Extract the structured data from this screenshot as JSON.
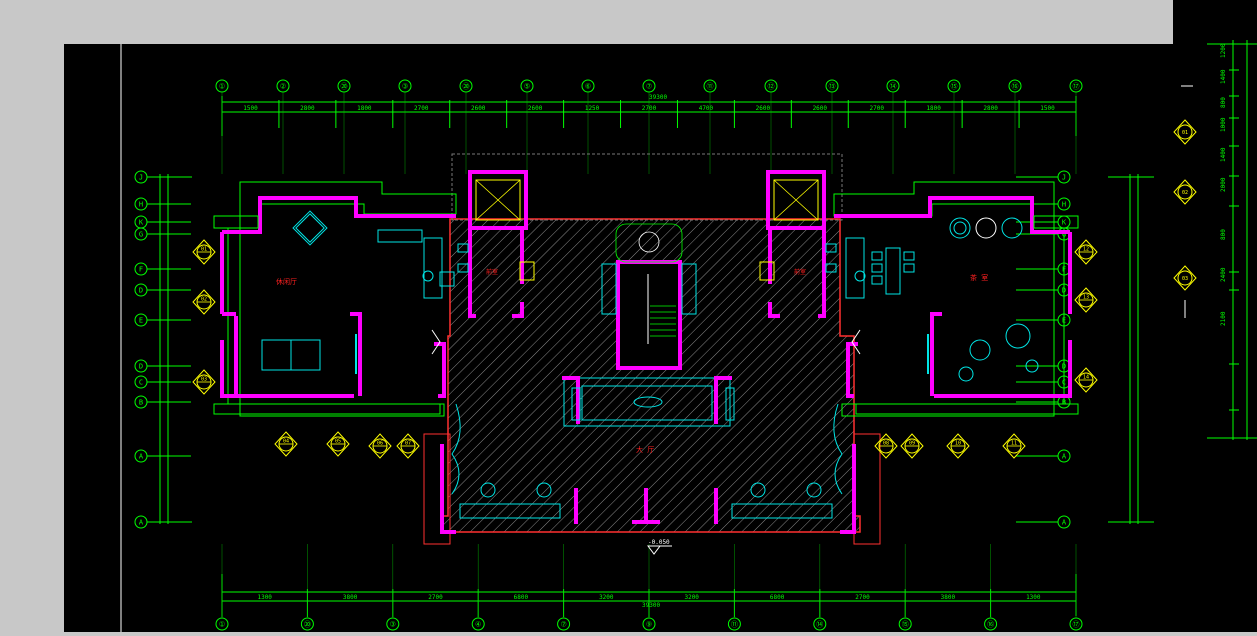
{
  "colors": {
    "background": "#000000",
    "grid": "#00ff00",
    "wall": "#ff00ff",
    "furniture": "#00e5e5",
    "marker": "#ffff00",
    "label": "#ff2020",
    "hatch": "#9a9a9a",
    "frame": "#ffffff",
    "window_chrome": "#c8c8c8"
  },
  "grid": {
    "top_axes": [
      "①",
      "②",
      "⑳",
      "③",
      "⑳",
      "⑤",
      "⑥",
      "⑦",
      "⑪",
      "⑫",
      "⑬",
      "⑭",
      "⑮",
      "⑯",
      "⑰"
    ],
    "bottom_axes": [
      "①",
      "⑳",
      "③",
      "④",
      "⑦",
      "⑨",
      "⑪",
      "⑭",
      "⑮",
      "⑯",
      "⑰"
    ],
    "left_axes": [
      "J",
      "H",
      "K",
      "G",
      "F",
      "D",
      "E",
      "D",
      "C",
      "B",
      "A",
      "A"
    ],
    "right_axes": [
      "J",
      "H",
      "K",
      "G",
      "F",
      "D",
      "E",
      "D",
      "C",
      "B",
      "A",
      "A"
    ],
    "top_dims": [
      "1500",
      "2800",
      "1800",
      "2700",
      "2600",
      "2600",
      "1250",
      "2700",
      "4700",
      "2600",
      "2600",
      "2700",
      "1800",
      "2800",
      "1500"
    ],
    "top_total": "39300",
    "bottom_dims": [
      "1300",
      "3800",
      "2700",
      "6800",
      "3200",
      "3200",
      "6800",
      "2700",
      "3800",
      "1300"
    ],
    "bottom_total": "39300",
    "right_side_dims": [
      "1200",
      "1400",
      "800",
      "1000",
      "1400",
      "2000",
      "800",
      "2400",
      "2100"
    ]
  },
  "rooms": {
    "left": "休闲厅",
    "right": "茶 室",
    "center": "大 厅",
    "left_small": "前室",
    "right_small": "前室"
  },
  "section_markers": [
    "01",
    "02",
    "03",
    "04",
    "05",
    "06",
    "07",
    "08",
    "09",
    "10",
    "11",
    "12",
    "13",
    "14"
  ],
  "elevation": "-0.050"
}
